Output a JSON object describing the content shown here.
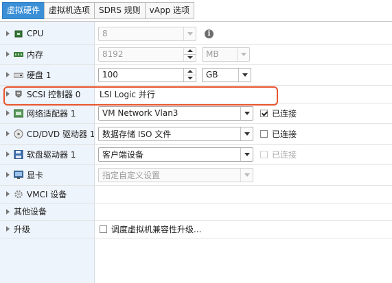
{
  "tabs": [
    "虚拟硬件",
    "虚拟机选项",
    "SDRS 规则",
    "vApp 选项"
  ],
  "rows": {
    "cpu": {
      "label": "CPU",
      "value": "8"
    },
    "memory": {
      "label": "内存",
      "value": "8192",
      "unit": "MB"
    },
    "disk": {
      "label": "硬盘 1",
      "value": "100",
      "unit": "GB"
    },
    "scsi": {
      "label": "SCSI 控制器 0",
      "value": "LSI Logic 并行"
    },
    "network": {
      "label": "网络适配器 1",
      "value": "VM Network Vlan3",
      "connected_label": "已连接",
      "connected": true
    },
    "cdrom": {
      "label": "CD/DVD 驱动器 1",
      "value": "数据存储 ISO 文件",
      "connected_label": "已连接",
      "connected": false
    },
    "floppy": {
      "label": "软盘驱动器 1",
      "value": "客户端设备",
      "connected_label": "已连接",
      "connected": false
    },
    "video": {
      "label": "显卡",
      "value": "指定自定义设置"
    },
    "vmci": {
      "label": "VMCI 设备"
    },
    "other": {
      "label": "其他设备"
    },
    "upgrade": {
      "label": "升级",
      "checkbox_label": "调度虚拟机兼容性升级..."
    }
  },
  "highlight_color": "#e8542c",
  "active_tab_color": "#3a8fd7"
}
